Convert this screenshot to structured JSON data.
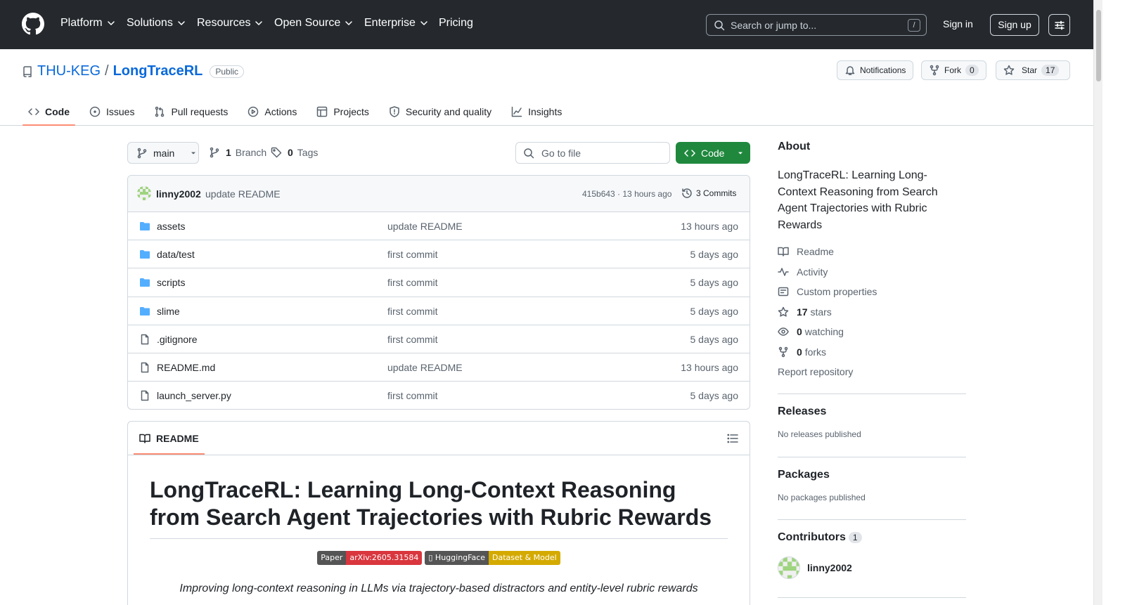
{
  "header": {
    "nav": [
      "Platform",
      "Solutions",
      "Resources",
      "Open Source",
      "Enterprise",
      "Pricing"
    ],
    "search_placeholder": "Search or jump to...",
    "search_shortcut": "/",
    "signin": "Sign in",
    "signup": "Sign up"
  },
  "repo": {
    "owner": "THU-KEG",
    "separator": "/",
    "name": "LongTraceRL",
    "visibility": "Public",
    "notifications_label": "Notifications",
    "fork_label": "Fork",
    "fork_count": "0",
    "star_label": "Star",
    "star_count": "17"
  },
  "tabs": [
    "Code",
    "Issues",
    "Pull requests",
    "Actions",
    "Projects",
    "Security and quality",
    "Insights"
  ],
  "browser": {
    "branch": "main",
    "branch_count": "1",
    "branch_label": "Branch",
    "tag_count": "0",
    "tag_label": "Tags",
    "goto_placeholder": "Go to file",
    "code_label": "Code"
  },
  "commit": {
    "author": "linny2002",
    "message": "update README",
    "meta": "415b643 · 13 hours ago",
    "count_label": "3 Commits"
  },
  "files": [
    {
      "name": "assets",
      "type": "folder",
      "message": "update README",
      "age": "13 hours ago"
    },
    {
      "name": "data/test",
      "type": "folder",
      "message": "first commit",
      "age": "5 days ago"
    },
    {
      "name": "scripts",
      "type": "folder",
      "message": "first commit",
      "age": "5 days ago"
    },
    {
      "name": "slime",
      "type": "folder",
      "message": "first commit",
      "age": "5 days ago"
    },
    {
      "name": ".gitignore",
      "type": "file",
      "message": "first commit",
      "age": "5 days ago"
    },
    {
      "name": "README.md",
      "type": "file",
      "message": "update README",
      "age": "13 hours ago"
    },
    {
      "name": "launch_server.py",
      "type": "file",
      "message": "first commit",
      "age": "5 days ago"
    }
  ],
  "readme": {
    "tab_label": "README",
    "title": "LongTraceRL: Learning Long-Context Reasoning from Search Agent Trajectories with Rubric Rewards",
    "badges": [
      {
        "left": "Paper",
        "right": "arXiv:2605.31584",
        "left_color": "#555555",
        "right_color": "#d9363e"
      },
      {
        "left": "▯ HuggingFace",
        "right": "Dataset & Model",
        "left_color": "#555555",
        "right_color": "#d4aa00"
      }
    ],
    "subtitle": "Improving long-context reasoning in LLMs via trajectory-based distractors and entity-level rubric rewards"
  },
  "sidebar": {
    "about_heading": "About",
    "description": "LongTraceRL: Learning Long-Context Reasoning from Search Agent Trajectories with Rubric Rewards",
    "readme": "Readme",
    "activity": "Activity",
    "custom_properties": "Custom properties",
    "stars_count": "17",
    "stars_label": "stars",
    "watching_count": "0",
    "watching_label": "watching",
    "forks_count": "0",
    "forks_label": "forks",
    "report": "Report repository",
    "releases_heading": "Releases",
    "releases_text": "No releases published",
    "packages_heading": "Packages",
    "packages_text": "No packages published",
    "contributors_heading": "Contributors",
    "contributors_count": "1",
    "contributor": "linny2002"
  },
  "colors": {
    "header_bg": "#25292e",
    "link": "#0969da",
    "code_button": "#1f883d",
    "active_tab": "#fd8c73",
    "folder": "#54aeff"
  }
}
